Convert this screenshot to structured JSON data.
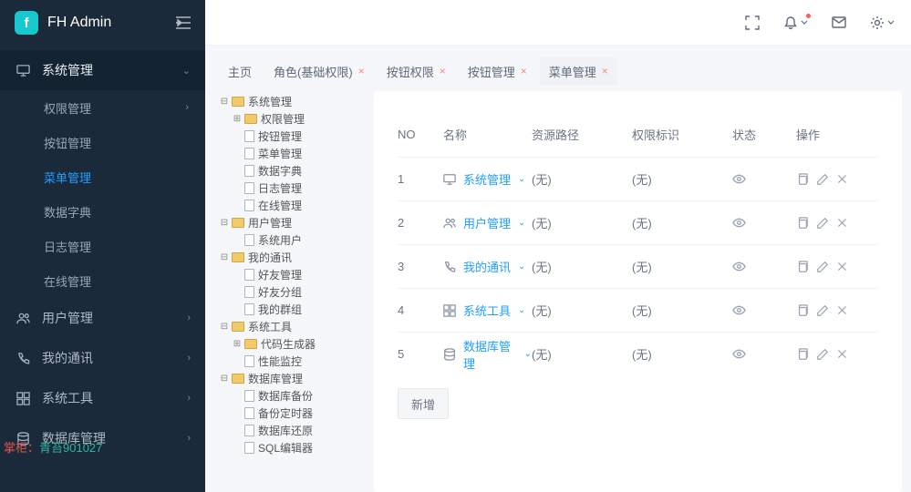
{
  "brand": {
    "title": "FH Admin",
    "logo_letter": "f"
  },
  "sidebar": {
    "sections": [
      {
        "label": "系统管理",
        "expanded": true,
        "children": [
          {
            "label": "权限管理",
            "has_children": true
          },
          {
            "label": "按钮管理"
          },
          {
            "label": "菜单管理",
            "active": true
          },
          {
            "label": "数据字典"
          },
          {
            "label": "日志管理"
          },
          {
            "label": "在线管理"
          }
        ]
      },
      {
        "label": "用户管理",
        "icon": "users"
      },
      {
        "label": "我的通讯",
        "icon": "phone"
      },
      {
        "label": "系统工具",
        "icon": "grid"
      },
      {
        "label": "数据库管理",
        "icon": "database"
      }
    ]
  },
  "tabs": [
    {
      "label": "主页",
      "closable": false
    },
    {
      "label": "角色(基础权限)",
      "closable": true
    },
    {
      "label": "按钮权限",
      "closable": true
    },
    {
      "label": "按钮管理",
      "closable": true
    },
    {
      "label": "菜单管理",
      "closable": true,
      "active": true
    }
  ],
  "tree": [
    {
      "label": "系统管理",
      "type": "folder",
      "expanded": true,
      "children": [
        {
          "label": "权限管理",
          "type": "folder",
          "expanded": false,
          "has_children": true
        },
        {
          "label": "按钮管理",
          "type": "file"
        },
        {
          "label": "菜单管理",
          "type": "file"
        },
        {
          "label": "数据字典",
          "type": "file"
        },
        {
          "label": "日志管理",
          "type": "file"
        },
        {
          "label": "在线管理",
          "type": "file"
        }
      ]
    },
    {
      "label": "用户管理",
      "type": "folder",
      "expanded": true,
      "children": [
        {
          "label": "系统用户",
          "type": "file"
        }
      ]
    },
    {
      "label": "我的通讯",
      "type": "folder",
      "expanded": true,
      "children": [
        {
          "label": "好友管理",
          "type": "file"
        },
        {
          "label": "好友分组",
          "type": "file"
        },
        {
          "label": "我的群组",
          "type": "file"
        }
      ]
    },
    {
      "label": "系统工具",
      "type": "folder",
      "expanded": true,
      "children": [
        {
          "label": "代码生成器",
          "type": "folder",
          "expanded": false,
          "has_children": true
        },
        {
          "label": "性能监控",
          "type": "file"
        }
      ]
    },
    {
      "label": "数据库管理",
      "type": "folder",
      "expanded": true,
      "children": [
        {
          "label": "数据库备份",
          "type": "file"
        },
        {
          "label": "备份定时器",
          "type": "file"
        },
        {
          "label": "数据库还原",
          "type": "file"
        },
        {
          "label": "SQL编辑器",
          "type": "file"
        }
      ]
    }
  ],
  "table": {
    "headers": {
      "no": "NO",
      "name": "名称",
      "path": "资源路径",
      "perm": "权限标识",
      "status": "状态",
      "action": "操作"
    },
    "rows": [
      {
        "no": 1,
        "name": "系统管理",
        "icon": "monitor",
        "path": "(无)",
        "perm": "(无)"
      },
      {
        "no": 2,
        "name": "用户管理",
        "icon": "users",
        "path": "(无)",
        "perm": "(无)"
      },
      {
        "no": 3,
        "name": "我的通讯",
        "icon": "phone",
        "path": "(无)",
        "perm": "(无)"
      },
      {
        "no": 4,
        "name": "系统工具",
        "icon": "grid",
        "path": "(无)",
        "perm": "(无)"
      },
      {
        "no": 5,
        "name": "数据库管理",
        "icon": "database",
        "path": "(无)",
        "perm": "(无)"
      }
    ],
    "add_button": "新增"
  },
  "footer": {
    "prefix": "掌柜：",
    "code": "青苔901027"
  }
}
